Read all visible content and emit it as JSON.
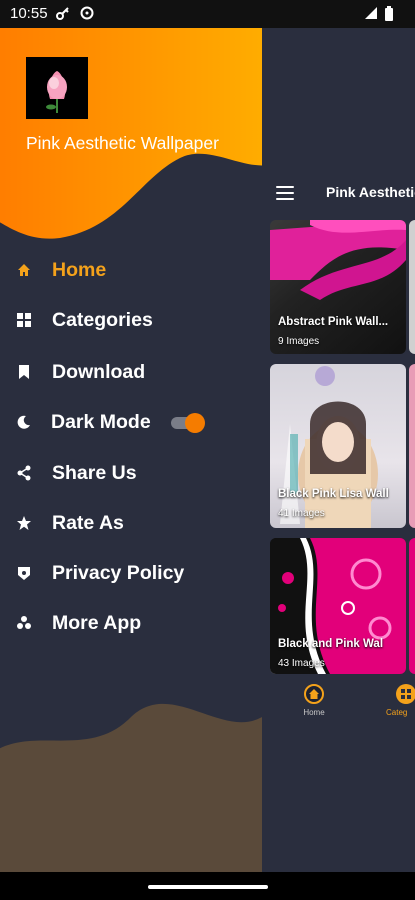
{
  "status_bar": {
    "time": "10:55"
  },
  "drawer": {
    "app_name": "Pink Aesthetic Wallpaper",
    "menu": [
      {
        "label": "Home",
        "icon": "home-icon",
        "active": true
      },
      {
        "label": "Categories",
        "icon": "grid-icon",
        "active": false
      },
      {
        "label": "Download",
        "icon": "bookmark-icon",
        "active": false
      },
      {
        "label": "Dark Mode",
        "icon": "moon-icon",
        "active": false,
        "toggle": true
      },
      {
        "label": "Share Us",
        "icon": "share-icon",
        "active": false
      },
      {
        "label": "Rate As",
        "icon": "star-icon",
        "active": false
      },
      {
        "label": "Privacy Policy",
        "icon": "shield-icon",
        "active": false
      },
      {
        "label": "More App",
        "icon": "apps-icon",
        "active": false
      }
    ],
    "dark_mode_on": true
  },
  "app": {
    "title": "Pink Aesthetic",
    "cards": [
      {
        "label": "Abstract Pink Wall...",
        "count": "9 Images"
      },
      {
        "label": "Black Pink Lisa Wall",
        "count": "41 Images"
      },
      {
        "label": "Black and Pink Wal",
        "count": "43 Images"
      }
    ],
    "bottom_nav": [
      {
        "label": "Home",
        "icon": "home-icon"
      },
      {
        "label": "Categ",
        "icon": "grid-icon"
      }
    ]
  },
  "colors": {
    "accent": "#f4a21b",
    "background": "#2a2e3e",
    "header_orange": "#ff8a00"
  }
}
